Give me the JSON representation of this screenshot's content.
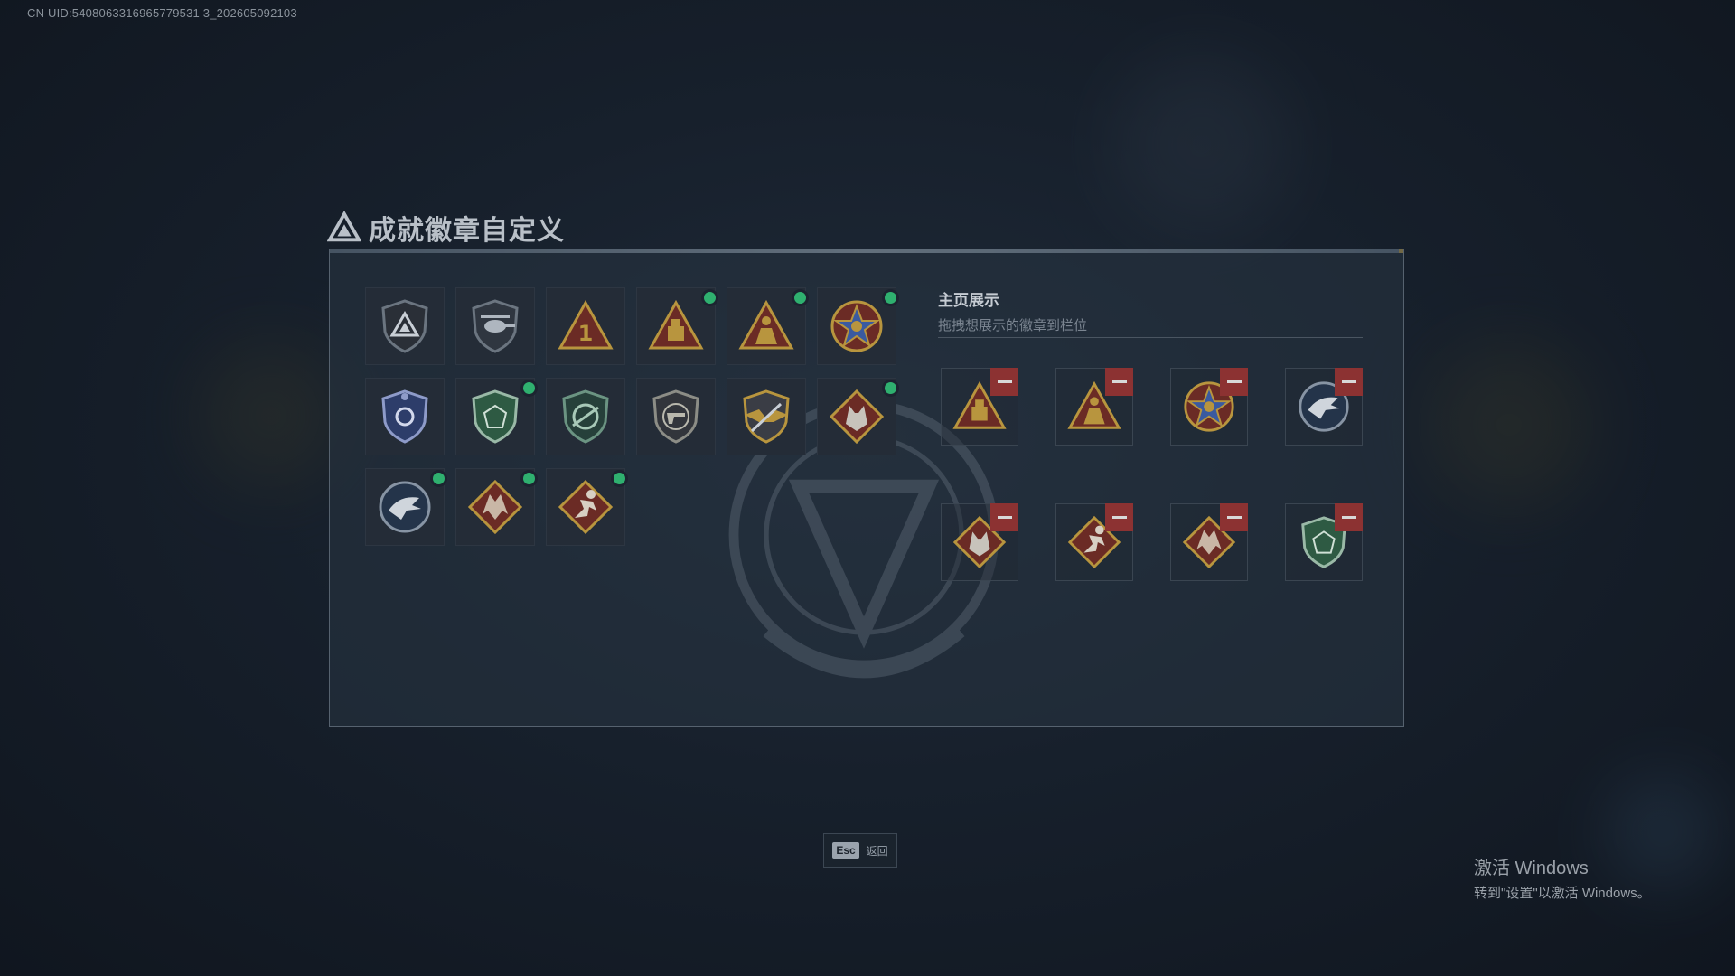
{
  "uid_text": "CN UID:5408063316965779531 3_202605092103",
  "title": "成就徽章自定义",
  "showcase": {
    "title": "主页展示",
    "subtitle": "拖拽想展示的徽章到栏位"
  },
  "badges": [
    {
      "icon": "triangle-shield-badge-icon",
      "equipped": false
    },
    {
      "icon": "helicopter-shield-badge-icon",
      "equipped": false
    },
    {
      "icon": "number-one-triangle-badge-icon",
      "equipped": false
    },
    {
      "icon": "supply-crate-triangle-badge-icon",
      "equipped": true
    },
    {
      "icon": "soldier-triangle-badge-icon",
      "equipped": true
    },
    {
      "icon": "star-medal-badge-icon",
      "equipped": true
    },
    {
      "icon": "police-blue-shield-badge-icon",
      "equipped": false
    },
    {
      "icon": "green-beret-shield-badge-icon",
      "equipped": true
    },
    {
      "icon": "crosshair-rifle-badge-icon",
      "equipped": false
    },
    {
      "icon": "pistol-target-badge-icon",
      "equipped": false
    },
    {
      "icon": "gold-wings-rifles-badge-icon",
      "equipped": false
    },
    {
      "icon": "wolf-diamond-badge-icon",
      "equipped": true
    },
    {
      "icon": "eagle-circle-badge-icon",
      "equipped": true
    },
    {
      "icon": "dragon-diamond-badge-icon",
      "equipped": true
    },
    {
      "icon": "runner-diamond-badge-icon",
      "equipped": true
    }
  ],
  "slots": [
    "supply-crate-triangle-badge-icon",
    "soldier-triangle-badge-icon",
    "star-medal-badge-icon",
    "eagle-circle-badge-icon",
    "wolf-diamond-badge-icon",
    "runner-diamond-badge-icon",
    "dragon-diamond-badge-icon",
    "green-beret-shield-badge-icon"
  ],
  "footer": {
    "esc_key": "Esc",
    "esc_label": "返回"
  },
  "windows_activation": {
    "line1": "激活 Windows",
    "line2": "转到\"设置\"以激活 Windows。"
  },
  "colors": {
    "equipped_dot": "#2fb06f",
    "remove_button": "#8c3232",
    "accent_gold": "#c9a64d"
  }
}
